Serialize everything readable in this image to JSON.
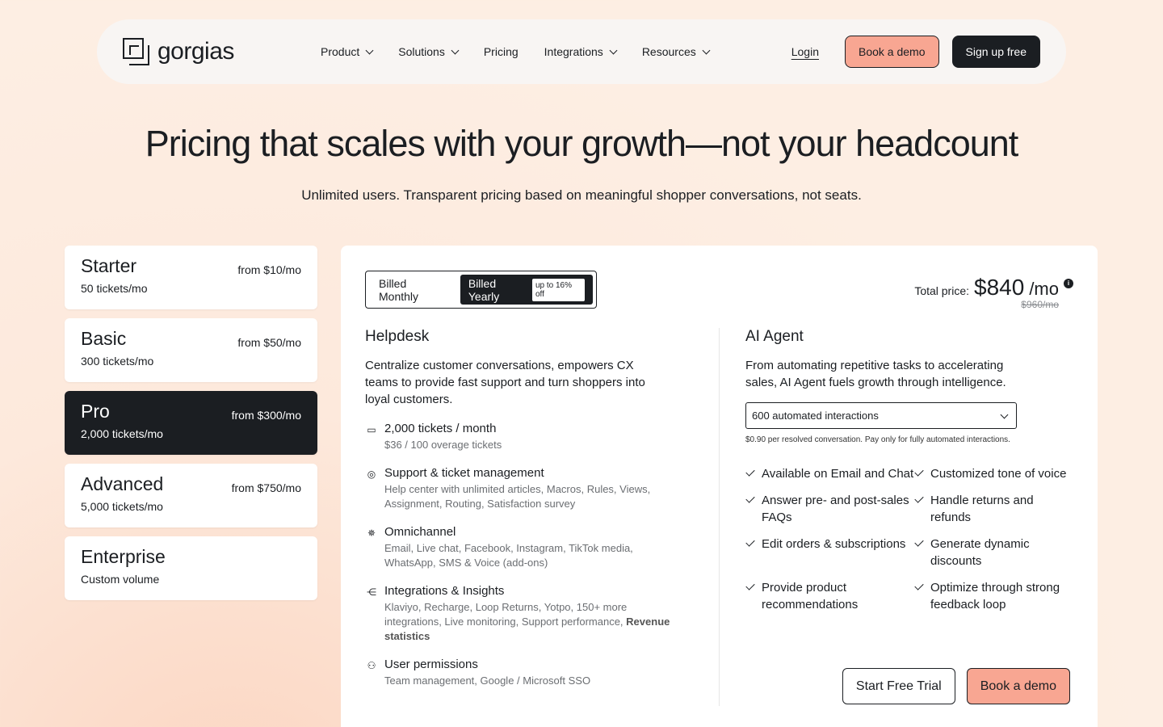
{
  "nav": {
    "logo_text": "gorgias",
    "links": [
      {
        "label": "Product",
        "dropdown": true
      },
      {
        "label": "Solutions",
        "dropdown": true
      },
      {
        "label": "Pricing",
        "dropdown": false
      },
      {
        "label": "Integrations",
        "dropdown": true
      },
      {
        "label": "Resources",
        "dropdown": true
      }
    ],
    "login_label": "Login",
    "demo_label": "Book a demo",
    "signup_label": "Sign up free"
  },
  "hero": {
    "title": "Pricing that scales with your growth—not your headcount",
    "subtitle": "Unlimited users. Transparent pricing based on meaningful shopper conversations, not seats."
  },
  "plans": [
    {
      "name": "Starter",
      "volume": "50 tickets/mo",
      "price": "from $10/mo",
      "active": false
    },
    {
      "name": "Basic",
      "volume": "300 tickets/mo",
      "price": "from $50/mo",
      "active": false
    },
    {
      "name": "Pro",
      "volume": "2,000 tickets/mo",
      "price": "from $300/mo",
      "active": true
    },
    {
      "name": "Advanced",
      "volume": "5,000 tickets/mo",
      "price": "from $750/mo",
      "active": false
    },
    {
      "name": "Enterprise",
      "volume": "Custom volume",
      "price": "",
      "active": false
    }
  ],
  "billing": {
    "monthly_label": "Billed Monthly",
    "yearly_label": "Billed Yearly",
    "yearly_badge": "up to 16% off"
  },
  "total": {
    "label": "Total price:",
    "price": "$840",
    "unit": "/mo",
    "old_price": "$960/mo"
  },
  "helpdesk": {
    "title": "Helpdesk",
    "description": "Centralize customer conversations, empowers CX teams to provide fast support and turn shoppers into loyal customers.",
    "features": [
      {
        "icon": "ticket-icon",
        "glyph": "▭",
        "title": "2,000 tickets / month",
        "sub": "$36 / 100 overage tickets",
        "bold": ""
      },
      {
        "icon": "support-icon",
        "glyph": "◎",
        "title": "Support & ticket management",
        "sub": "Help center with unlimited articles, Macros, Rules, Views, Assignment, Routing, Satisfaction survey",
        "bold": ""
      },
      {
        "icon": "omnichannel-icon",
        "glyph": "✵",
        "title": "Omnichannel",
        "sub": "Email, Live chat, Facebook, Instagram, TikTok media, WhatsApp, SMS & Voice (add-ons)",
        "bold": ""
      },
      {
        "icon": "integrations-icon",
        "glyph": "⋲",
        "title": "Integrations & Insights",
        "sub": "Klaviyo, Recharge, Loop Returns, Yotpo, 150+ more integrations, Live monitoring, Support performance,",
        "bold": "Revenue statistics"
      },
      {
        "icon": "user-permissions-icon",
        "glyph": "⚇",
        "title": "User permissions",
        "sub": "Team management, Google / Microsoft SSO",
        "bold": ""
      }
    ]
  },
  "ai_agent": {
    "title": "AI Agent",
    "description": "From automating repetitive tasks to accelerating sales, AI Agent fuels growth through intelligence.",
    "select_value": "600 automated interactions",
    "select_note": "$0.90 per resolved conversation. Pay only for fully automated interactions.",
    "checks": [
      "Available on Email and Chat",
      "Customized tone of voice",
      "Answer pre- and post-sales FAQs",
      "Handle returns and refunds",
      "Edit orders & subscriptions",
      "Generate dynamic discounts",
      "Provide product recommendations",
      "Optimize through strong feedback loop"
    ]
  },
  "actions": {
    "trial_label": "Start Free Trial",
    "demo_label": "Book a demo"
  },
  "colors": {
    "accent": "#f8a692",
    "dark": "#1b1e22",
    "background": "#fdeee3"
  }
}
